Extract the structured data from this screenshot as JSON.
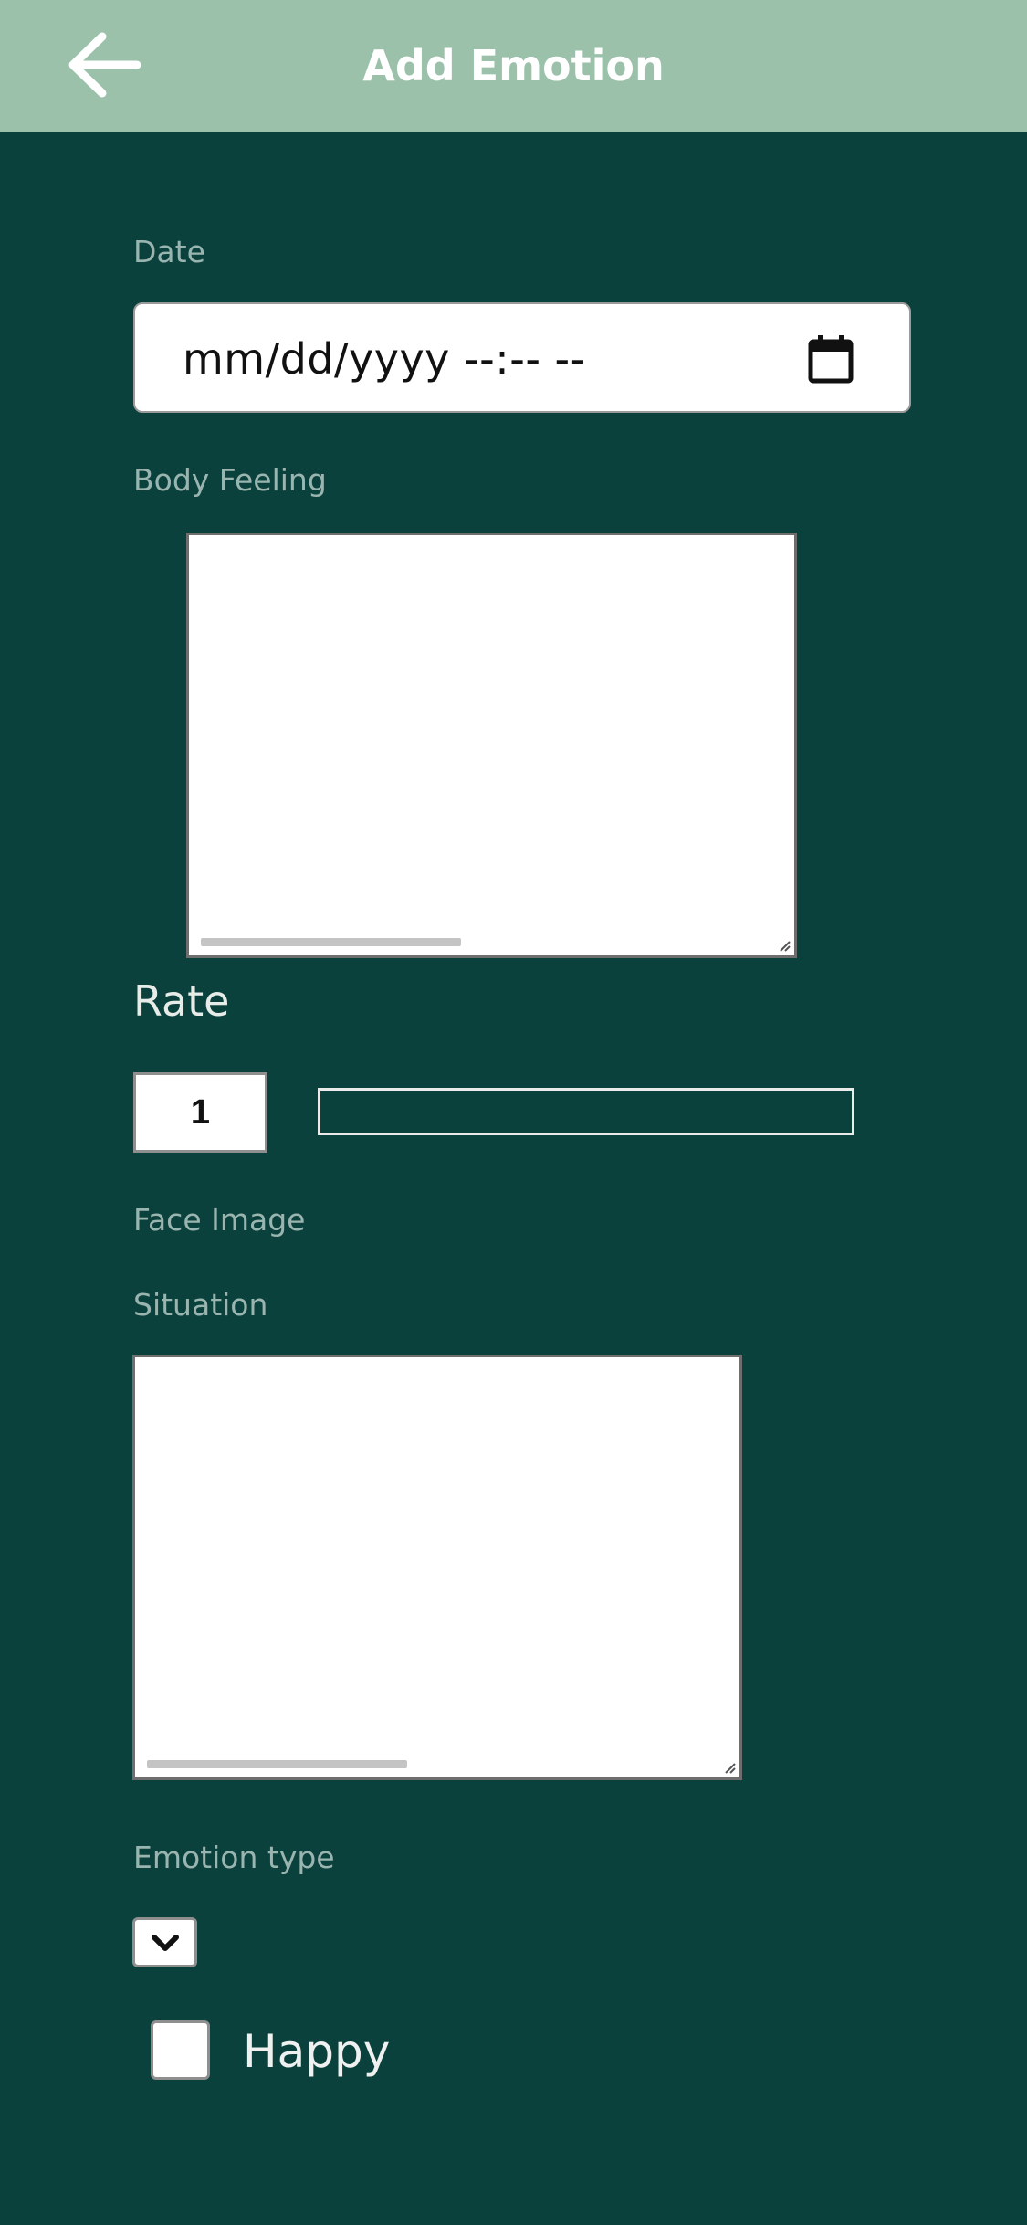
{
  "header": {
    "title": "Add Emotion",
    "back_icon": "arrow-left-icon"
  },
  "form": {
    "date_label": "Date",
    "date_placeholder": "mm/dd/yyyy  --:-- --",
    "calendar_icon": "calendar-icon",
    "body_feeling_label": "Body Feeling",
    "body_feeling_value": "",
    "rate_title": "Rate",
    "rate_value": "1",
    "face_image_label": "Face Image",
    "situation_label": "Situation",
    "situation_value": "",
    "emotion_type_label": "Emotion type",
    "emotion_type_selected": "",
    "checkbox_label": "Happy",
    "checkbox_checked": false
  },
  "colors": {
    "background": "#0b413c",
    "header": "#9bc1ab",
    "label": "#9ab5b0"
  }
}
